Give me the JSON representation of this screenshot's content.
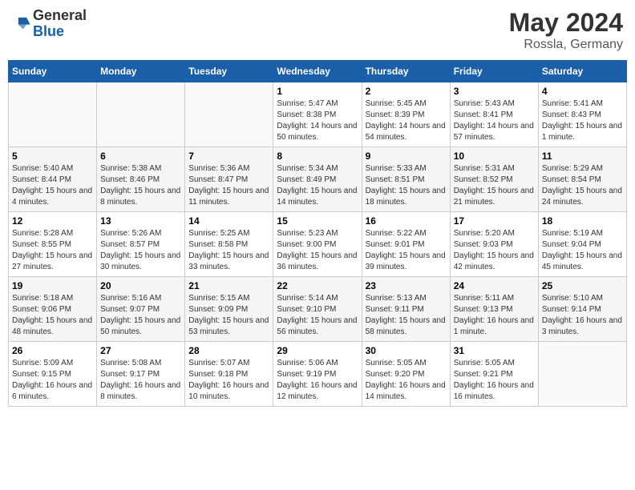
{
  "header": {
    "logo_general": "General",
    "logo_blue": "Blue",
    "month_year": "May 2024",
    "location": "Rossla, Germany"
  },
  "weekdays": [
    "Sunday",
    "Monday",
    "Tuesday",
    "Wednesday",
    "Thursday",
    "Friday",
    "Saturday"
  ],
  "weeks": [
    [
      {
        "day": "",
        "sunrise": "",
        "sunset": "",
        "daylight": ""
      },
      {
        "day": "",
        "sunrise": "",
        "sunset": "",
        "daylight": ""
      },
      {
        "day": "",
        "sunrise": "",
        "sunset": "",
        "daylight": ""
      },
      {
        "day": "1",
        "sunrise": "Sunrise: 5:47 AM",
        "sunset": "Sunset: 8:38 PM",
        "daylight": "Daylight: 14 hours and 50 minutes."
      },
      {
        "day": "2",
        "sunrise": "Sunrise: 5:45 AM",
        "sunset": "Sunset: 8:39 PM",
        "daylight": "Daylight: 14 hours and 54 minutes."
      },
      {
        "day": "3",
        "sunrise": "Sunrise: 5:43 AM",
        "sunset": "Sunset: 8:41 PM",
        "daylight": "Daylight: 14 hours and 57 minutes."
      },
      {
        "day": "4",
        "sunrise": "Sunrise: 5:41 AM",
        "sunset": "Sunset: 8:43 PM",
        "daylight": "Daylight: 15 hours and 1 minute."
      }
    ],
    [
      {
        "day": "5",
        "sunrise": "Sunrise: 5:40 AM",
        "sunset": "Sunset: 8:44 PM",
        "daylight": "Daylight: 15 hours and 4 minutes."
      },
      {
        "day": "6",
        "sunrise": "Sunrise: 5:38 AM",
        "sunset": "Sunset: 8:46 PM",
        "daylight": "Daylight: 15 hours and 8 minutes."
      },
      {
        "day": "7",
        "sunrise": "Sunrise: 5:36 AM",
        "sunset": "Sunset: 8:47 PM",
        "daylight": "Daylight: 15 hours and 11 minutes."
      },
      {
        "day": "8",
        "sunrise": "Sunrise: 5:34 AM",
        "sunset": "Sunset: 8:49 PM",
        "daylight": "Daylight: 15 hours and 14 minutes."
      },
      {
        "day": "9",
        "sunrise": "Sunrise: 5:33 AM",
        "sunset": "Sunset: 8:51 PM",
        "daylight": "Daylight: 15 hours and 18 minutes."
      },
      {
        "day": "10",
        "sunrise": "Sunrise: 5:31 AM",
        "sunset": "Sunset: 8:52 PM",
        "daylight": "Daylight: 15 hours and 21 minutes."
      },
      {
        "day": "11",
        "sunrise": "Sunrise: 5:29 AM",
        "sunset": "Sunset: 8:54 PM",
        "daylight": "Daylight: 15 hours and 24 minutes."
      }
    ],
    [
      {
        "day": "12",
        "sunrise": "Sunrise: 5:28 AM",
        "sunset": "Sunset: 8:55 PM",
        "daylight": "Daylight: 15 hours and 27 minutes."
      },
      {
        "day": "13",
        "sunrise": "Sunrise: 5:26 AM",
        "sunset": "Sunset: 8:57 PM",
        "daylight": "Daylight: 15 hours and 30 minutes."
      },
      {
        "day": "14",
        "sunrise": "Sunrise: 5:25 AM",
        "sunset": "Sunset: 8:58 PM",
        "daylight": "Daylight: 15 hours and 33 minutes."
      },
      {
        "day": "15",
        "sunrise": "Sunrise: 5:23 AM",
        "sunset": "Sunset: 9:00 PM",
        "daylight": "Daylight: 15 hours and 36 minutes."
      },
      {
        "day": "16",
        "sunrise": "Sunrise: 5:22 AM",
        "sunset": "Sunset: 9:01 PM",
        "daylight": "Daylight: 15 hours and 39 minutes."
      },
      {
        "day": "17",
        "sunrise": "Sunrise: 5:20 AM",
        "sunset": "Sunset: 9:03 PM",
        "daylight": "Daylight: 15 hours and 42 minutes."
      },
      {
        "day": "18",
        "sunrise": "Sunrise: 5:19 AM",
        "sunset": "Sunset: 9:04 PM",
        "daylight": "Daylight: 15 hours and 45 minutes."
      }
    ],
    [
      {
        "day": "19",
        "sunrise": "Sunrise: 5:18 AM",
        "sunset": "Sunset: 9:06 PM",
        "daylight": "Daylight: 15 hours and 48 minutes."
      },
      {
        "day": "20",
        "sunrise": "Sunrise: 5:16 AM",
        "sunset": "Sunset: 9:07 PM",
        "daylight": "Daylight: 15 hours and 50 minutes."
      },
      {
        "day": "21",
        "sunrise": "Sunrise: 5:15 AM",
        "sunset": "Sunset: 9:09 PM",
        "daylight": "Daylight: 15 hours and 53 minutes."
      },
      {
        "day": "22",
        "sunrise": "Sunrise: 5:14 AM",
        "sunset": "Sunset: 9:10 PM",
        "daylight": "Daylight: 15 hours and 56 minutes."
      },
      {
        "day": "23",
        "sunrise": "Sunrise: 5:13 AM",
        "sunset": "Sunset: 9:11 PM",
        "daylight": "Daylight: 15 hours and 58 minutes."
      },
      {
        "day": "24",
        "sunrise": "Sunrise: 5:11 AM",
        "sunset": "Sunset: 9:13 PM",
        "daylight": "Daylight: 16 hours and 1 minute."
      },
      {
        "day": "25",
        "sunrise": "Sunrise: 5:10 AM",
        "sunset": "Sunset: 9:14 PM",
        "daylight": "Daylight: 16 hours and 3 minutes."
      }
    ],
    [
      {
        "day": "26",
        "sunrise": "Sunrise: 5:09 AM",
        "sunset": "Sunset: 9:15 PM",
        "daylight": "Daylight: 16 hours and 6 minutes."
      },
      {
        "day": "27",
        "sunrise": "Sunrise: 5:08 AM",
        "sunset": "Sunset: 9:17 PM",
        "daylight": "Daylight: 16 hours and 8 minutes."
      },
      {
        "day": "28",
        "sunrise": "Sunrise: 5:07 AM",
        "sunset": "Sunset: 9:18 PM",
        "daylight": "Daylight: 16 hours and 10 minutes."
      },
      {
        "day": "29",
        "sunrise": "Sunrise: 5:06 AM",
        "sunset": "Sunset: 9:19 PM",
        "daylight": "Daylight: 16 hours and 12 minutes."
      },
      {
        "day": "30",
        "sunrise": "Sunrise: 5:05 AM",
        "sunset": "Sunset: 9:20 PM",
        "daylight": "Daylight: 16 hours and 14 minutes."
      },
      {
        "day": "31",
        "sunrise": "Sunrise: 5:05 AM",
        "sunset": "Sunset: 9:21 PM",
        "daylight": "Daylight: 16 hours and 16 minutes."
      },
      {
        "day": "",
        "sunrise": "",
        "sunset": "",
        "daylight": ""
      }
    ]
  ]
}
